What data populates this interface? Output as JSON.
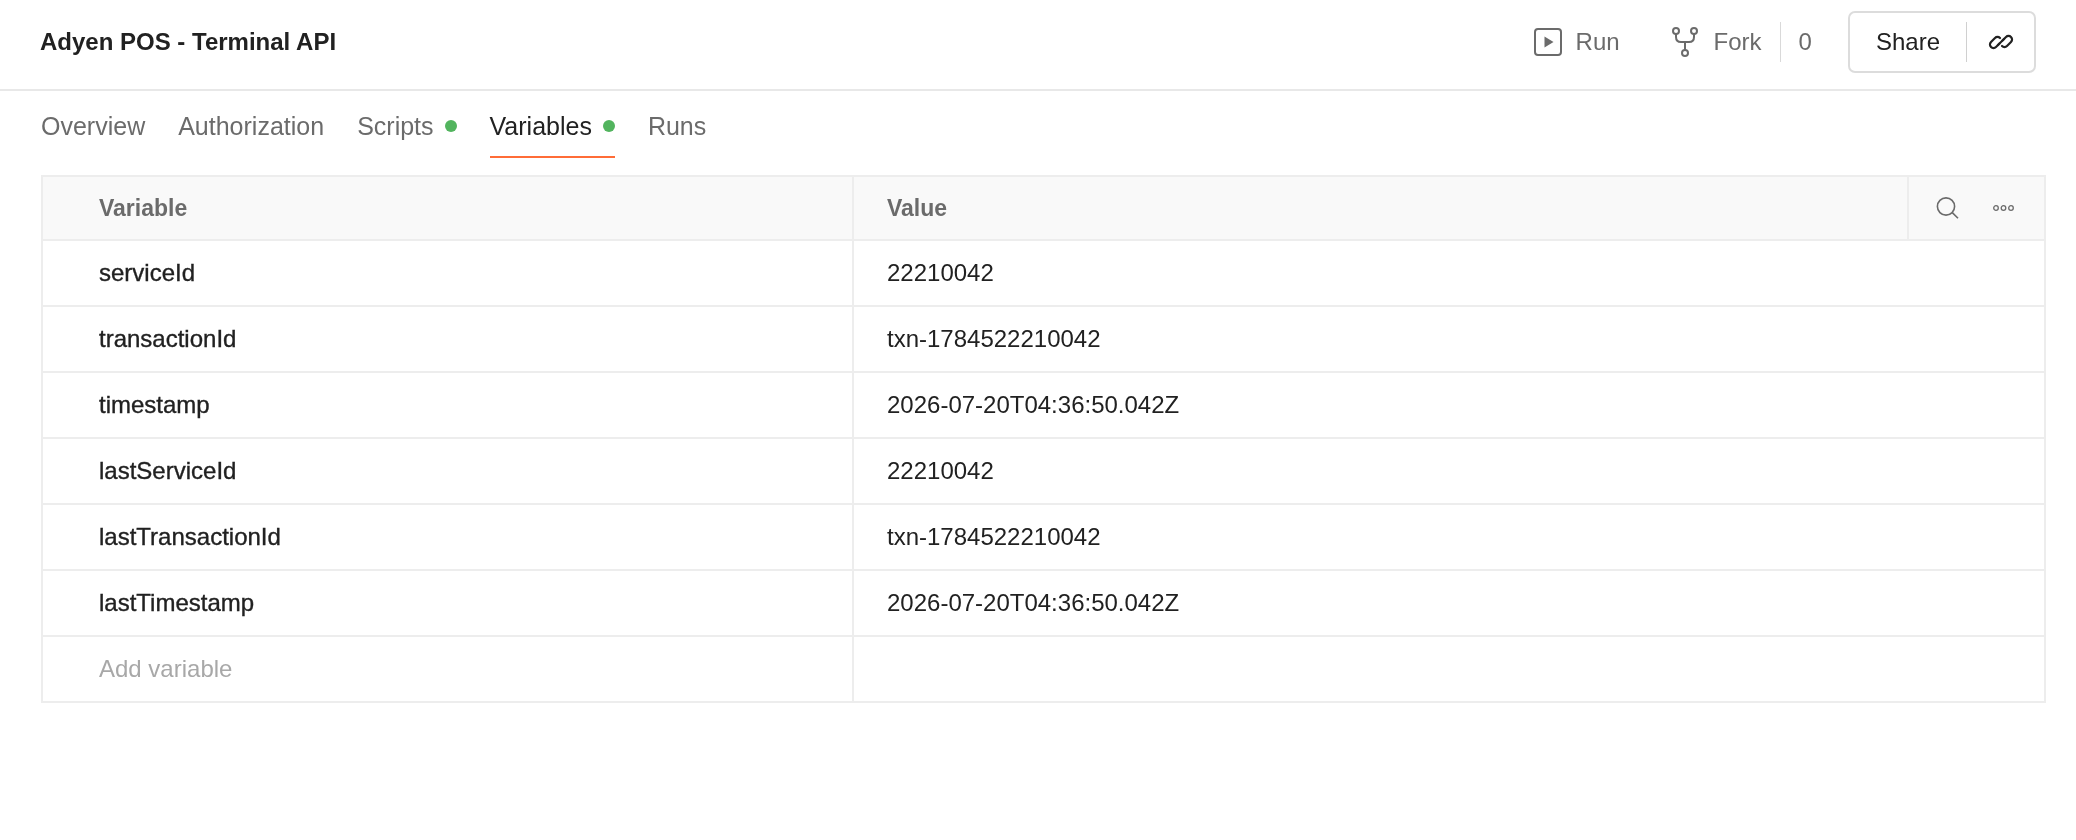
{
  "window": {
    "title": "Adyen POS - Terminal API"
  },
  "actions": {
    "run": "Run",
    "fork": "Fork",
    "fork_count": "0",
    "share": "Share"
  },
  "tabs": [
    {
      "label": "Overview",
      "selected": false,
      "dot": false
    },
    {
      "label": "Authorization",
      "selected": false,
      "dot": false
    },
    {
      "label": "Scripts",
      "selected": false,
      "dot": true
    },
    {
      "label": "Variables",
      "selected": true,
      "dot": true
    },
    {
      "label": "Runs",
      "selected": false,
      "dot": false
    }
  ],
  "table": {
    "columns": [
      "Variable",
      "Value"
    ],
    "rows": [
      {
        "variable": "serviceId",
        "value": "22210042"
      },
      {
        "variable": "transactionId",
        "value": "txn-1784522210042"
      },
      {
        "variable": "timestamp",
        "value": "2026-07-20T04:36:50.042Z"
      },
      {
        "variable": "lastServiceId",
        "value": "22210042"
      },
      {
        "variable": "lastTransactionId",
        "value": "txn-1784522210042"
      },
      {
        "variable": "lastTimestamp",
        "value": "2026-07-20T04:36:50.042Z"
      }
    ],
    "new_row": {
      "placeholder": "Add variable"
    }
  }
}
